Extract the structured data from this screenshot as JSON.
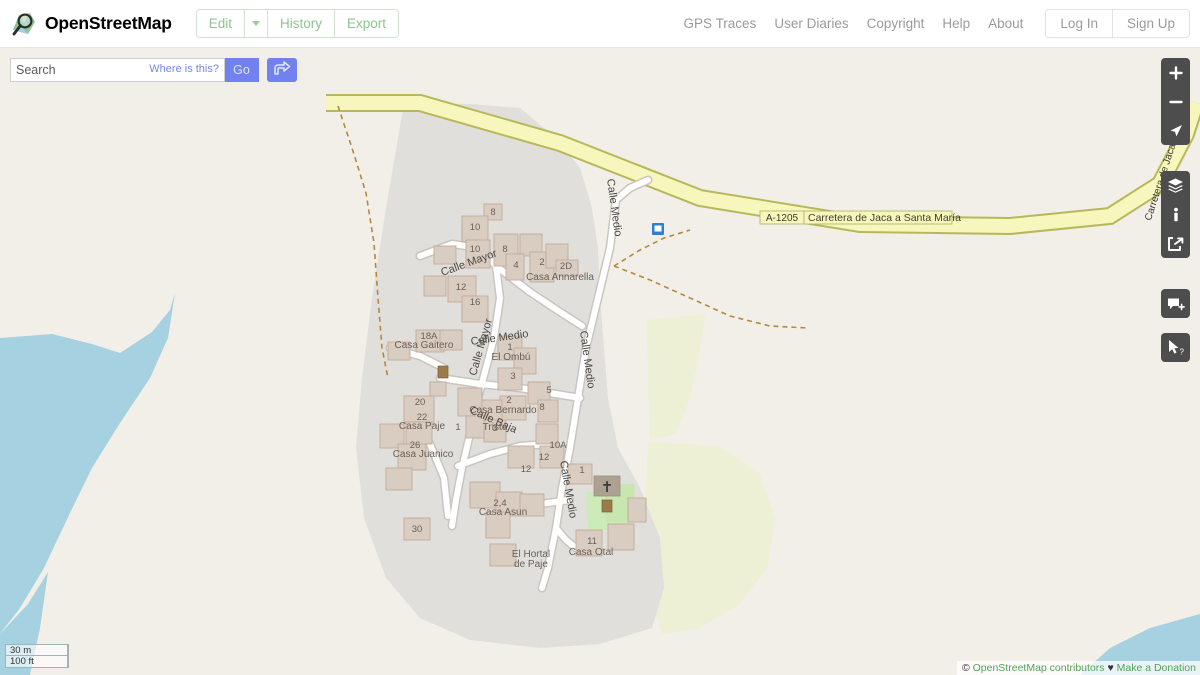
{
  "header": {
    "brand_title": "OpenStreetMap",
    "logo_icon": "osm-magnifier-logo",
    "edit_label": "Edit",
    "edit_caret_icon": "chevron-down-icon",
    "history_label": "History",
    "export_label": "Export",
    "nav_links": [
      {
        "label": "GPS Traces"
      },
      {
        "label": "User Diaries"
      },
      {
        "label": "Copyright"
      },
      {
        "label": "Help"
      },
      {
        "label": "About"
      }
    ],
    "login_label": "Log In",
    "signup_label": "Sign Up"
  },
  "search": {
    "placeholder": "Search",
    "value": "",
    "where_is_this": "Where is this?",
    "go_label": "Go",
    "directions_icon": "directions-arrow-icon"
  },
  "map_controls": {
    "zoom_in": "+",
    "zoom_out": "−",
    "locate_icon": "locate-arrow-icon",
    "layers_icon": "layers-stack-icon",
    "info_icon": "info-i-icon",
    "share_icon": "share-export-icon",
    "note_icon": "add-note-icon",
    "query_icon": "query-cursor-icon"
  },
  "scale": {
    "metric": "30 m",
    "imperial": "100 ft"
  },
  "attribution": {
    "copyright_symbol": "©",
    "contributors": "OpenStreetMap contributors",
    "heart": "♥",
    "donation": "Make a Donation"
  },
  "map": {
    "colors": {
      "background": "#f2efe9",
      "water": "#a5d1e0",
      "residential": "#e0dfdb",
      "building": "#d9ccc0",
      "building_outline": "#c2ab9b",
      "farmland": "#eef0d5",
      "grass": "#cdebb8",
      "road_white": "#ffffff",
      "road_yellow": "#f7f7bd",
      "road_yellow_casing": "#b8b85a",
      "path_dashed": "#b5883a",
      "church_fill": "#ada292",
      "garden": "#d6e7c4",
      "bus_marker": "#3080d0"
    },
    "highway": {
      "ref": "A-1205",
      "name": "Carretera de Jaca a Santa María",
      "curved_label": "Carretera de Jaca a Sant"
    },
    "streets": [
      {
        "name": "Calle Mayor"
      },
      {
        "name": "Calle Mayor"
      },
      {
        "name": "Calle Medio"
      },
      {
        "name": "Calle Medio"
      },
      {
        "name": "Calle Medio"
      },
      {
        "name": "Calle Medio"
      },
      {
        "name": "Calle Baja"
      }
    ],
    "house_numbers": [
      "8",
      "10",
      "10",
      "8",
      "4",
      "2",
      "2D",
      "12",
      "16",
      "18A",
      "1",
      "3",
      "5",
      "2",
      "8",
      "1",
      "3",
      "20",
      "22",
      "26",
      "30",
      "10A",
      "12",
      "12",
      "1",
      "2,4",
      "11"
    ],
    "place_names": [
      "Casa Annarella",
      "Casa Gaitero",
      "El Ombú",
      "Casa Bernardo",
      "Casa Paje",
      "Triste",
      "Casa Juanico",
      "Casa Asun",
      "El Hortal",
      "de Paje",
      "Casa Otal"
    ],
    "markers": [
      {
        "name": "bus-stop-marker"
      },
      {
        "name": "amenity-marker"
      },
      {
        "name": "amenity-marker"
      },
      {
        "name": "church-cross-marker"
      }
    ]
  }
}
